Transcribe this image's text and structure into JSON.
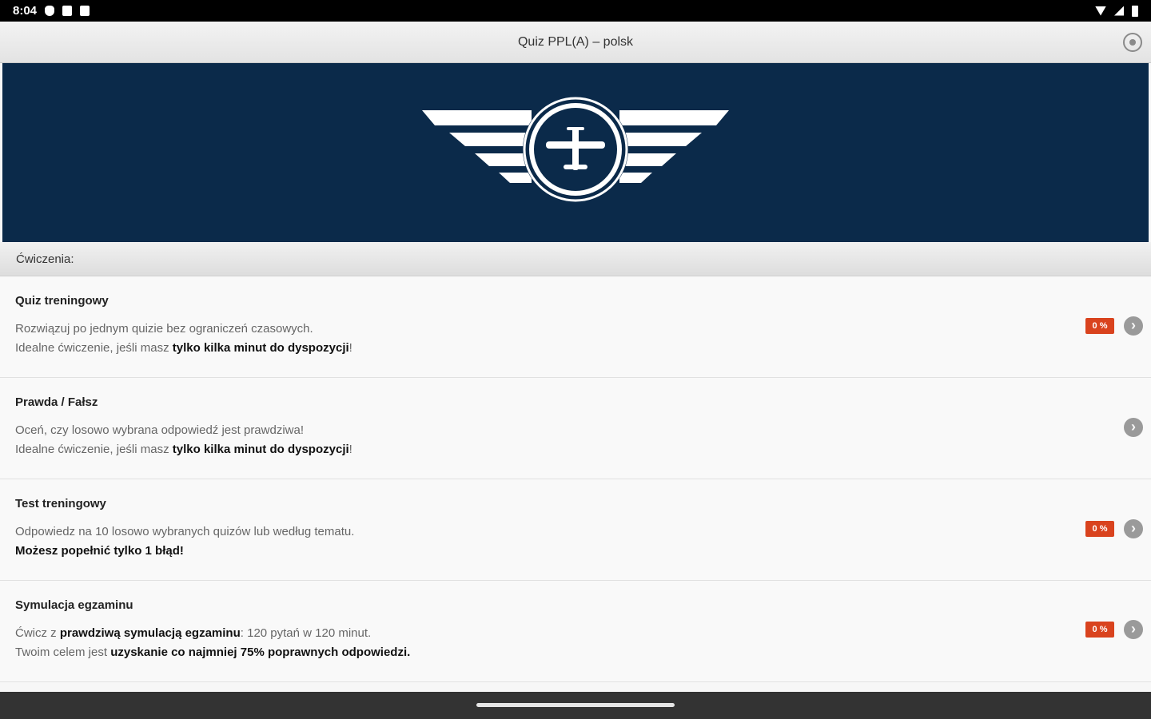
{
  "status_bar": {
    "time": "8:04",
    "left_icons": [
      "shield-icon",
      "sd-card-icon",
      "notification-icon"
    ],
    "right_icons": [
      "wifi-icon",
      "signal-icon",
      "battery-icon"
    ]
  },
  "header": {
    "title": "Quiz PPL(A) – polsk",
    "settings_icon": "settings-icon"
  },
  "banner": {
    "background_color": "#0b2a4a",
    "logo_icon": "winged-airplane-logo"
  },
  "section": {
    "title": "Ćwiczenia:"
  },
  "items": [
    {
      "title": "Quiz treningowy",
      "line1_plain": "Rozwiązuj po jednym quizie bez ograniczeń czasowych.",
      "line2_prefix": "Idealne ćwiczenie, jeśli masz ",
      "line2_bold": "tylko kilka minut do dyspozycji",
      "line2_suffix": "!",
      "badge": "0 %"
    },
    {
      "title": "Prawda / Fałsz",
      "line1_plain": "Oceń, czy losowo wybrana odpowiedź jest prawdziwa!",
      "line2_prefix": "Idealne ćwiczenie, jeśli masz ",
      "line2_bold": "tylko kilka minut do dyspozycji",
      "line2_suffix": "!"
    },
    {
      "title": "Test treningowy",
      "line1_plain": "Odpowiedz na 10 losowo wybranych quizów lub według tematu.",
      "line2_bold": "Możesz popełnić tylko 1 błąd!",
      "badge": "0 %"
    },
    {
      "title": "Symulacja egzaminu",
      "line1_prefix": "Ćwicz z ",
      "line1_bold": "prawdziwą symulacją egzaminu",
      "line1_suffix": ": 120 pytań w 120 minut.",
      "line2_prefix": "Twoim celem jest ",
      "line2_bold": "uzyskanie co najmniej 75% poprawnych odpowiedzi.",
      "badge": "0 %"
    }
  ],
  "colors": {
    "badge": "#d9431e",
    "banner": "#0b2a4a"
  }
}
